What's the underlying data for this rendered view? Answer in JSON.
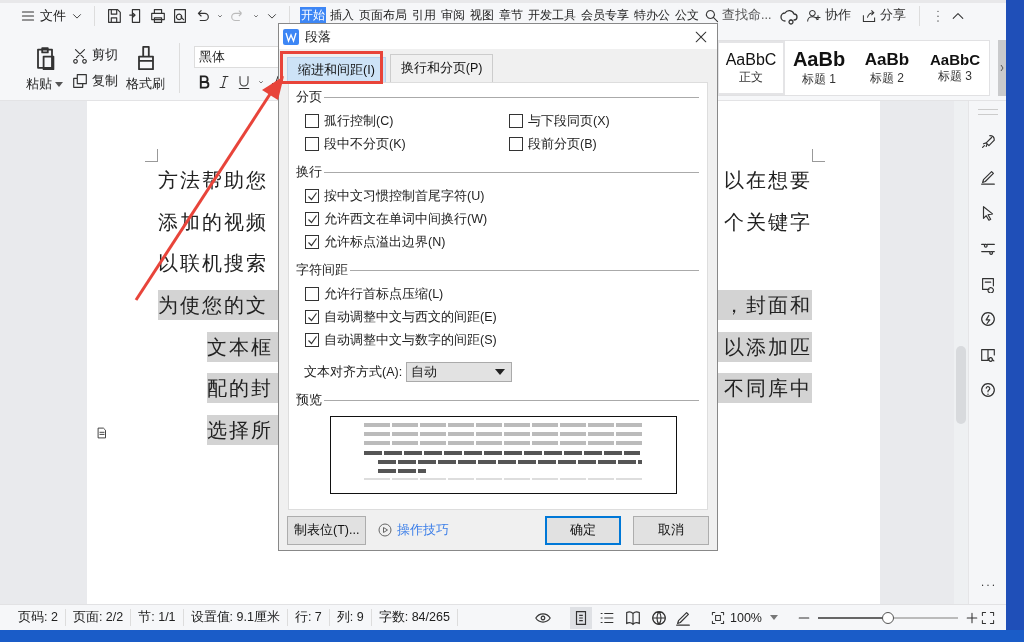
{
  "menu": {
    "label": "文件"
  },
  "ribbon_tabs": [
    {
      "label": "开始",
      "selected": true
    },
    {
      "label": "插入",
      "selected": false
    },
    {
      "label": "页面布局",
      "selected": false
    },
    {
      "label": "引用",
      "selected": false
    },
    {
      "label": "审阅",
      "selected": false
    },
    {
      "label": "视图",
      "selected": false
    },
    {
      "label": "章节",
      "selected": false
    },
    {
      "label": "开发工具",
      "selected": false
    },
    {
      "label": "会员专享",
      "selected": false
    },
    {
      "label": "特办公",
      "selected": false
    },
    {
      "label": "公文",
      "selected": false
    }
  ],
  "search": {
    "placeholder": "查找命..."
  },
  "top_actions": [
    {
      "label": "协作",
      "kind": "collab"
    },
    {
      "label": "分享",
      "kind": "share"
    }
  ],
  "clipboard": {
    "paste": "粘贴",
    "cut": "剪切",
    "copy": "复制",
    "format_painter": "格式刷"
  },
  "font": {
    "value": "黑体"
  },
  "styles": [
    {
      "sample": "AaBbC",
      "label": "正文",
      "selected": true,
      "kind": "normal"
    },
    {
      "sample": "AaBb",
      "label": "标题 1",
      "selected": false,
      "kind": "h1"
    },
    {
      "sample": "AaBb",
      "label": "标题 2",
      "selected": false,
      "kind": "h2"
    },
    {
      "sample": "AaBbC",
      "label": "标题 3",
      "selected": false,
      "kind": "h3"
    }
  ],
  "document": {
    "lines": [
      {
        "left": "方法帮助您",
        "right": "以在想要",
        "highlighted": false,
        "indented": false
      },
      {
        "left": "添加的视频",
        "right": "个关键字",
        "highlighted": false,
        "indented": false
      },
      {
        "left": "以联机搜索",
        "highlighted": false,
        "indented": false
      },
      {
        "left": "为使您的文",
        "right": "，封面和",
        "highlighted": true,
        "indented": false
      },
      {
        "left": "文本框",
        "right": "以添加匹",
        "highlighted": true,
        "indented": true
      },
      {
        "left": "配的封",
        "right": "不同库中",
        "highlighted": true,
        "indented": true
      },
      {
        "left": "选择所",
        "highlighted": true,
        "indented": true
      }
    ]
  },
  "dialog": {
    "title": "段落",
    "tabs": [
      {
        "label": "缩进和间距(I)",
        "selected": true
      },
      {
        "label": "换行和分页(P)",
        "selected": false
      }
    ],
    "sections": [
      {
        "title": "分页",
        "kind": "grid",
        "options": [
          {
            "label": "孤行控制(C)",
            "checked": false
          },
          {
            "label": "与下段同页(X)",
            "checked": false
          },
          {
            "label": "段中不分页(K)",
            "checked": false
          },
          {
            "label": "段前分页(B)",
            "checked": false
          }
        ]
      },
      {
        "title": "换行",
        "kind": "list",
        "options": [
          {
            "label": "按中文习惯控制首尾字符(U)",
            "checked": true
          },
          {
            "label": "允许西文在单词中间换行(W)",
            "checked": true
          },
          {
            "label": "允许标点溢出边界(N)",
            "checked": true
          }
        ]
      },
      {
        "title": "字符间距",
        "kind": "list",
        "options": [
          {
            "label": "允许行首标点压缩(L)",
            "checked": false
          },
          {
            "label": "自动调整中文与西文的间距(E)",
            "checked": true
          },
          {
            "label": "自动调整中文与数字的间距(S)",
            "checked": true
          }
        ]
      }
    ],
    "alignment": {
      "label": "文本对齐方式(A):",
      "value": "自动"
    },
    "preview": {
      "title": "预览"
    },
    "buttons": [
      {
        "label": "制表位(T)...",
        "kind": "button"
      },
      {
        "label": "操作技巧",
        "kind": "link"
      },
      {
        "label": "确定",
        "kind": "primary"
      },
      {
        "label": "取消",
        "kind": "button"
      }
    ]
  },
  "status_bar": {
    "items": [
      "页码: 2",
      "页面: 2/2",
      "节: 1/1",
      "设置值: 9.1厘米",
      "行: 7",
      "列: 9",
      "字数: 84/265"
    ],
    "view_modes": [
      {
        "kind": "page",
        "selected": true
      },
      {
        "kind": "outline",
        "selected": false
      },
      {
        "kind": "reading",
        "selected": false
      },
      {
        "kind": "web",
        "selected": false
      }
    ],
    "zoom": "100%",
    "zoom_slider": {
      "level": 0.5
    }
  }
}
